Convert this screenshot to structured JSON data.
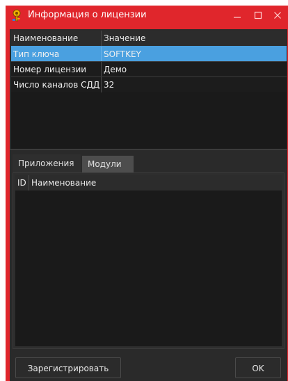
{
  "window": {
    "title": "Информация о лицензии",
    "icon": "key-icon"
  },
  "properties": {
    "headers": [
      "Наименование",
      "Значение"
    ],
    "rows": [
      {
        "name": "Тип ключа",
        "value": "SOFTKEY",
        "selected": true
      },
      {
        "name": "Номер лицензии",
        "value": "Демо",
        "selected": false
      },
      {
        "name": "Число каналов СДД",
        "value": "32",
        "selected": false
      }
    ]
  },
  "tabs": [
    {
      "label": "Приложения",
      "active": true
    },
    {
      "label": "Модули",
      "active": false
    }
  ],
  "apps_table": {
    "headers": [
      "ID",
      "Наименование"
    ]
  },
  "buttons": {
    "register": "Зарегистрировать",
    "ok": "OK"
  },
  "colors": {
    "titlebar": "#e0262c",
    "selection": "#4aa0e0",
    "background": "#2a2a2a"
  }
}
